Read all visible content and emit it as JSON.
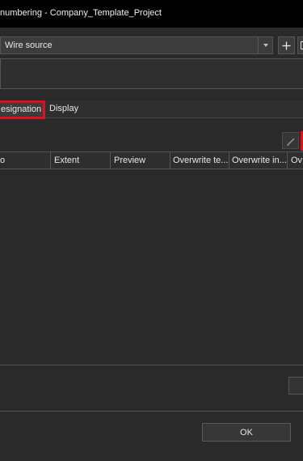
{
  "window": {
    "title": "numbering - Company_Template_Project"
  },
  "config": {
    "selected": "Wire source"
  },
  "tabs": [
    {
      "label": "esignation",
      "highlighted": true
    },
    {
      "label": "Display"
    }
  ],
  "grid": {
    "columns": [
      "o",
      "Extent",
      "Preview",
      "Overwrite te...",
      "Overwrite in...",
      "Ov"
    ]
  },
  "footer": {
    "ok_label": "OK"
  },
  "colors": {
    "highlight": "#e0101a",
    "background": "#2a2a2a",
    "titlebar": "#000000"
  },
  "icons": [
    "chevron-down-icon",
    "plus-icon",
    "copy-icon",
    "pencil-icon"
  ]
}
